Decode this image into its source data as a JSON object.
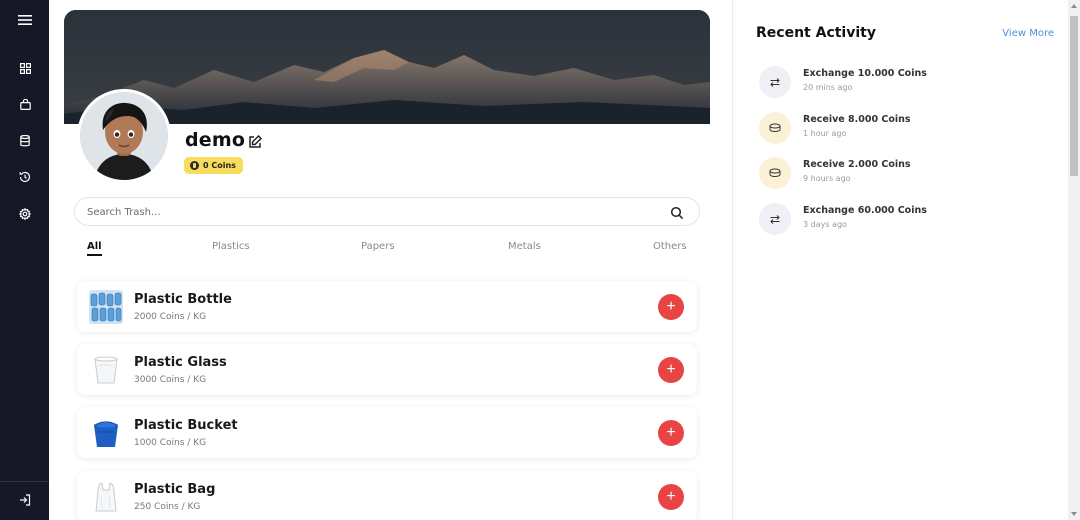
{
  "sidebar": {
    "items": [
      {
        "icon": "menu-icon"
      },
      {
        "icon": "dashboard-grid-icon"
      },
      {
        "icon": "shopping-bag-icon"
      },
      {
        "icon": "database-icon"
      },
      {
        "icon": "history-icon"
      },
      {
        "icon": "settings-gear-icon"
      }
    ],
    "logout_icon": "logout-icon"
  },
  "profile": {
    "username": "demo",
    "coins": "0 Coins",
    "edit_icon": "edit-icon",
    "coin_icon": "coin-icon"
  },
  "search": {
    "placeholder": "Search Trash...",
    "value": "",
    "icon": "search-icon"
  },
  "tabs": [
    {
      "label": "All",
      "active": true
    },
    {
      "label": "Plastics",
      "active": false
    },
    {
      "label": "Papers",
      "active": false
    },
    {
      "label": "Metals",
      "active": false
    },
    {
      "label": "Others",
      "active": false
    }
  ],
  "items": [
    {
      "name": "Plastic Bottle",
      "price": "2000 Coins / KG",
      "thumb": "plastic-bottle"
    },
    {
      "name": "Plastic Glass",
      "price": "3000 Coins / KG",
      "thumb": "plastic-glass"
    },
    {
      "name": "Plastic Bucket",
      "price": "1000 Coins / KG",
      "thumb": "plastic-bucket"
    },
    {
      "name": "Plastic Bag",
      "price": "250 Coins / KG",
      "thumb": "plastic-bag"
    }
  ],
  "add_button_label": "+",
  "recent_activity": {
    "title": "Recent Activity",
    "view_more": "View More",
    "items": [
      {
        "title": "Exchange 10.000 Coins",
        "time": "20 mins ago",
        "type": "exchange",
        "icon": "exchange-arrows-icon"
      },
      {
        "title": "Receive 8.000 Coins",
        "time": "1 hour ago",
        "type": "receive",
        "icon": "coin-stack-icon"
      },
      {
        "title": "Receive 2.000 Coins",
        "time": "9 hours ago",
        "type": "receive",
        "icon": "coin-stack-icon"
      },
      {
        "title": "Exchange 60.000 Coins",
        "time": "3 days ago",
        "type": "exchange",
        "icon": "exchange-arrows-icon"
      }
    ]
  },
  "colors": {
    "sidebar_bg": "#161727",
    "accent_red": "#e84444",
    "coin_yellow": "#f7dd5d",
    "link_blue": "#4a90d9"
  }
}
